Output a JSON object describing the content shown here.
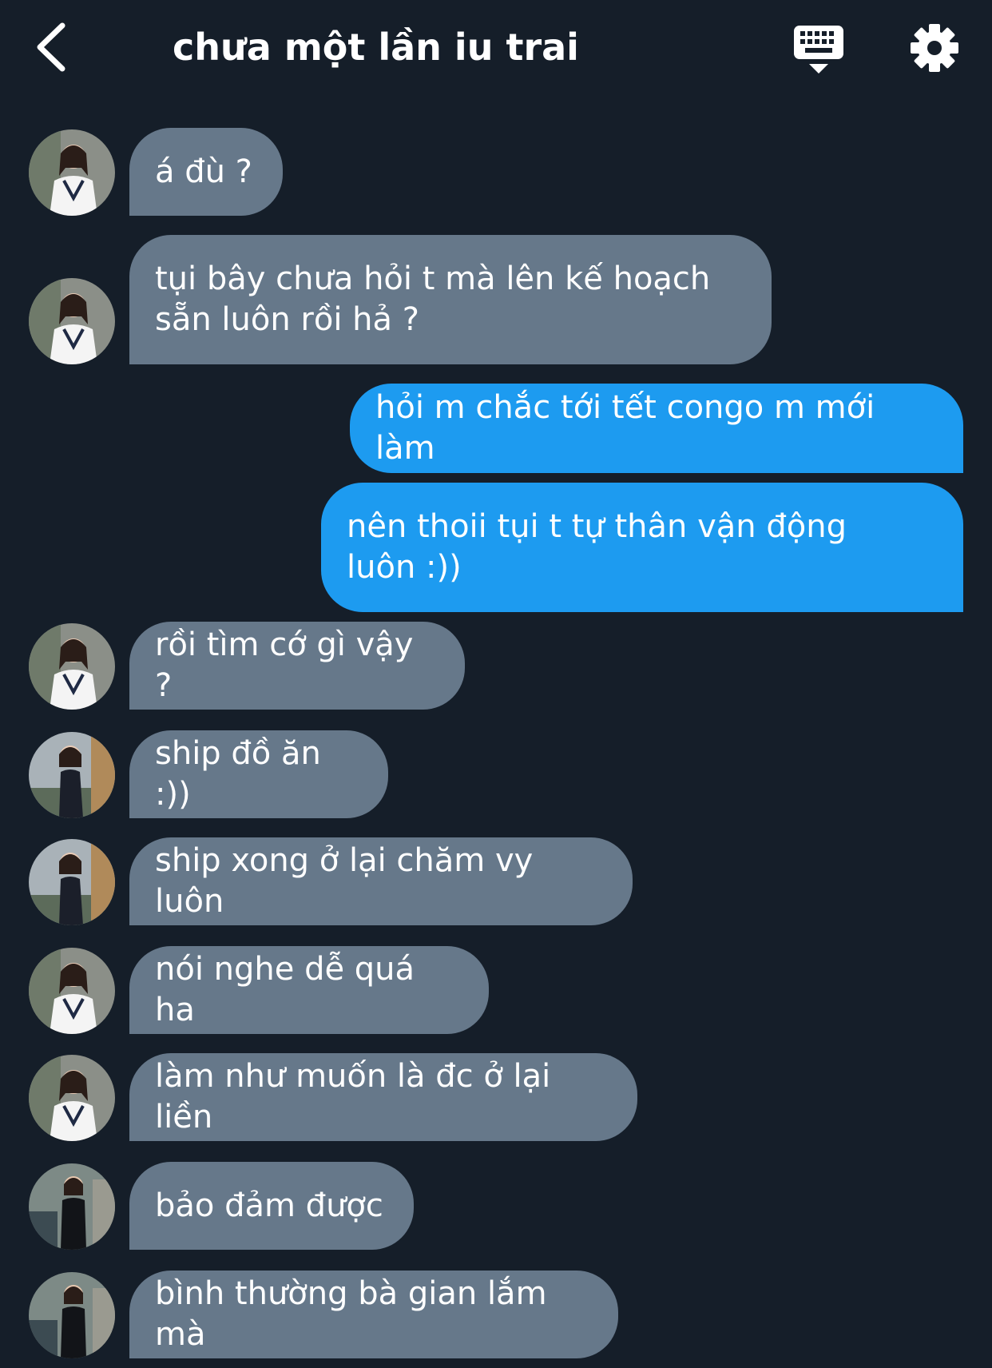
{
  "header": {
    "title": "chưa một lần iu trai",
    "back_icon": "chevron-left-icon",
    "keyboard_icon": "keyboard-dismiss-icon",
    "settings_icon": "gear-icon"
  },
  "colors": {
    "background": "#151e29",
    "incoming_bubble": "#66788a",
    "outgoing_bubble": "#1d9bf0",
    "text": "#ffffff"
  },
  "messages": [
    {
      "direction": "incoming",
      "avatar": "avatar-1",
      "text": "á đù ?"
    },
    {
      "direction": "incoming",
      "avatar": "avatar-1",
      "text": "tụi bây chưa hỏi t mà lên kế hoạch\nsẵn luôn rồi hả ?"
    },
    {
      "direction": "outgoing",
      "text": "hỏi m chắc tới tết congo m mới làm"
    },
    {
      "direction": "outgoing",
      "text": "nên thoii tụi t tự thân vận động\nluôn :))"
    },
    {
      "direction": "incoming",
      "avatar": "avatar-1",
      "text": "rồi tìm cớ gì vậy ?"
    },
    {
      "direction": "incoming",
      "avatar": "avatar-2",
      "text": "ship đồ ăn :))"
    },
    {
      "direction": "incoming",
      "avatar": "avatar-2",
      "text": "ship xong ở lại chăm vy luôn"
    },
    {
      "direction": "incoming",
      "avatar": "avatar-1",
      "text": "nói nghe dễ quá ha"
    },
    {
      "direction": "incoming",
      "avatar": "avatar-1",
      "text": "làm như muốn là đc ở lại liền"
    },
    {
      "direction": "incoming",
      "avatar": "avatar-3",
      "text": "bảo đảm được"
    },
    {
      "direction": "incoming",
      "avatar": "avatar-3",
      "text": "bình thường bà gian lắm mà"
    }
  ]
}
